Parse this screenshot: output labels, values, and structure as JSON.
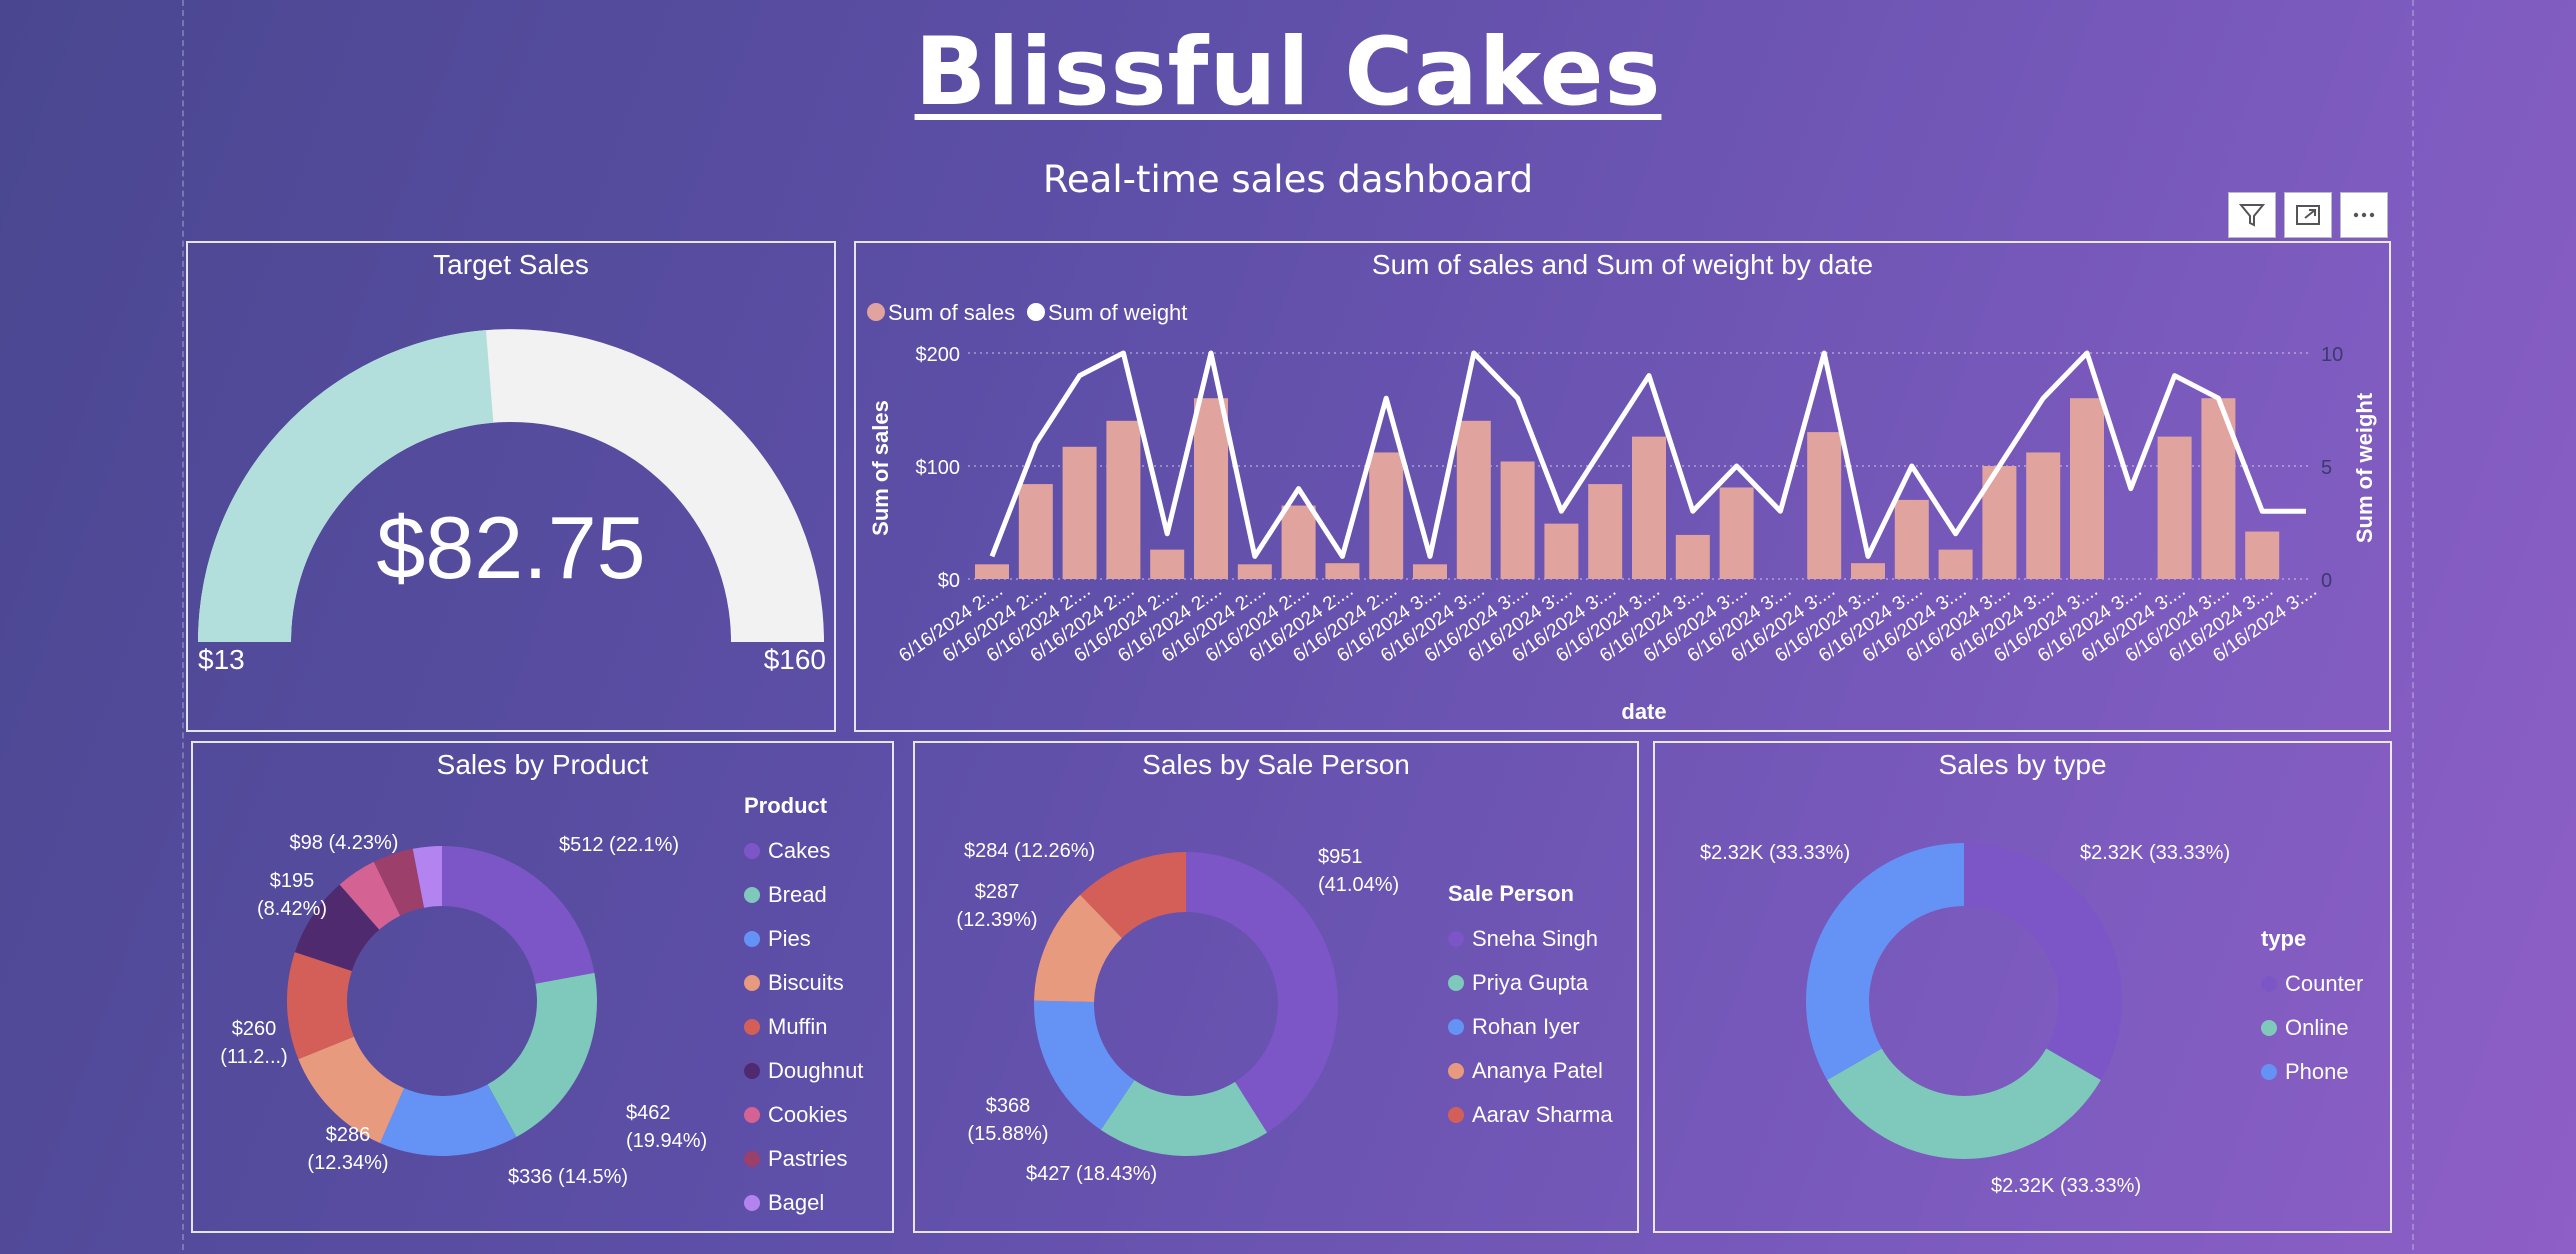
{
  "header": {
    "title": "Blissful Cakes",
    "subtitle": "Real-time sales dashboard"
  },
  "gauge": {
    "title": "Target Sales",
    "value_label": "$82.75",
    "min_label": "$13",
    "max_label": "$160",
    "value": 82.75,
    "min": 13,
    "max": 160,
    "fill_color": "#b2dfdb",
    "track_color": "#f2f2f2"
  },
  "combo": {
    "title": "Sum of sales and Sum of weight by date",
    "xlabel": "date",
    "ylabel": "Sum of sales",
    "y2label": "Sum of weight",
    "legend": [
      {
        "name": "Sum of sales",
        "color": "#e0a39e"
      },
      {
        "name": "Sum of weight",
        "color": "#ffffff"
      }
    ],
    "yticks": [
      "$0",
      "$100",
      "$200"
    ],
    "y2ticks": [
      "0",
      "5",
      "10"
    ]
  },
  "products": {
    "title": "Sales by Product",
    "legend_title": "Product",
    "labels": {
      "cakes": "$512 (22.1%)",
      "bread_1": "$462",
      "bread_2": "(19.94%)",
      "pies": "$336 (14.5%)",
      "biscuits_1": "$286",
      "biscuits_2": "(12.34%)",
      "muffin_1": "$260",
      "muffin_2": "(11.2...)",
      "doughnut_1": "$195",
      "doughnut_2": "(8.42%)",
      "cookies": "$98 (4.23%)"
    }
  },
  "salesperson": {
    "title": "Sales by Sale Person",
    "legend_title": "Sale Person",
    "labels": {
      "sneha_1": "$951",
      "sneha_2": "(41.04%)",
      "priya": "$427 (18.43%)",
      "rohan_1": "$368",
      "rohan_2": "(15.88%)",
      "ananya_1": "$287",
      "ananya_2": "(12.39%)",
      "aarav": "$284 (12.26%)"
    }
  },
  "types": {
    "title": "Sales by type",
    "legend_title": "type",
    "labels": {
      "counter": "$2.32K (33.33%)",
      "online": "$2.32K (33.33%)",
      "phone": "$2.32K (33.33%)"
    }
  },
  "chart_data": [
    {
      "type": "gauge",
      "title": "Target Sales",
      "value": 82.75,
      "min": 13,
      "max": 160
    },
    {
      "type": "bar+line",
      "title": "Sum of sales and Sum of weight by date",
      "xlabel": "date",
      "ylabel": "Sum of sales",
      "y2label": "Sum of weight",
      "ylim": [
        0,
        200
      ],
      "y2lim": [
        0,
        10
      ],
      "categories": [
        "6/16/2024 2:...",
        "6/16/2024 2:...",
        "6/16/2024 2:...",
        "6/16/2024 2:...",
        "6/16/2024 2:...",
        "6/16/2024 2:...",
        "6/16/2024 2:...",
        "6/16/2024 2:...",
        "6/16/2024 2:...",
        "6/16/2024 2:...",
        "6/16/2024 3:...",
        "6/16/2024 3:...",
        "6/16/2024 3:...",
        "6/16/2024 3:...",
        "6/16/2024 3:...",
        "6/16/2024 3:...",
        "6/16/2024 3:...",
        "6/16/2024 3:...",
        "6/16/2024 3:...",
        "6/16/2024 3:...",
        "6/16/2024 3:...",
        "6/16/2024 3:...",
        "6/16/2024 3:...",
        "6/16/2024 3:...",
        "6/16/2024 3:...",
        "6/16/2024 3:...",
        "6/16/2024 3:...",
        "6/16/2024 3:...",
        "6/16/2024 3:...",
        "6/16/2024 3:...",
        "6/16/2024 3:..."
      ],
      "series": [
        {
          "name": "Sum of sales",
          "kind": "bar",
          "color": "#e0a39e",
          "values": [
            13,
            84,
            117,
            140,
            26,
            160,
            13,
            65,
            14,
            112,
            13,
            140,
            104,
            49,
            84,
            126,
            39,
            81,
            0,
            130,
            14,
            70,
            26,
            100,
            112,
            160,
            0,
            126,
            160,
            42,
            0
          ]
        },
        {
          "name": "Sum of weight",
          "kind": "line",
          "color": "#ffffff",
          "values": [
            1,
            6,
            9,
            10,
            2,
            10,
            1,
            4,
            1,
            8,
            1,
            10,
            8,
            3,
            6,
            9,
            3,
            5,
            3,
            10,
            1,
            5,
            2,
            5,
            8,
            10,
            4,
            9,
            8,
            3,
            3
          ]
        }
      ]
    },
    {
      "type": "pie",
      "title": "Sales by Product",
      "labels": [
        "Cakes",
        "Bread",
        "Pies",
        "Biscuits",
        "Muffin",
        "Doughnut",
        "Cookies",
        "Pastries",
        "Bagel"
      ],
      "values": [
        512,
        462,
        336,
        286,
        260,
        195,
        98,
        98,
        70
      ],
      "colors": [
        "#7c55c7",
        "#7ec8bc",
        "#6592f5",
        "#e89a7e",
        "#d45f58",
        "#4f2a6f",
        "#d46292",
        "#9c3f6b",
        "#b384f0"
      ]
    },
    {
      "type": "pie",
      "title": "Sales by Sale Person",
      "labels": [
        "Sneha Singh",
        "Priya Gupta",
        "Rohan Iyer",
        "Ananya Patel",
        "Aarav Sharma"
      ],
      "values": [
        951,
        427,
        368,
        287,
        284
      ],
      "colors": [
        "#7c55c7",
        "#7ec8bc",
        "#6592f5",
        "#e89a7e",
        "#d45f58"
      ]
    },
    {
      "type": "pie",
      "title": "Sales by type",
      "labels": [
        "Counter",
        "Online",
        "Phone"
      ],
      "values": [
        2320,
        2320,
        2320
      ],
      "colors": [
        "#7c55c7",
        "#7ec8bc",
        "#6592f5"
      ]
    }
  ]
}
